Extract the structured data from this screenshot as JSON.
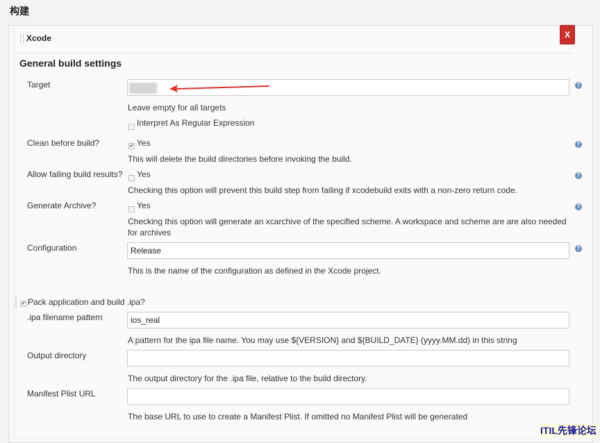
{
  "section": {
    "title": "构建"
  },
  "builder": {
    "title": "Xcode",
    "close_label": "X"
  },
  "general": {
    "title": "General build settings"
  },
  "target": {
    "label": "Target",
    "value": "",
    "help": "Leave empty for all targets",
    "regex_label": "Interpret As Regular Expression"
  },
  "clean": {
    "label": "Clean before build?",
    "yes": "Yes",
    "help": "This will delete the build directories before invoking the build."
  },
  "allow_failing": {
    "label": "Allow failing build results?",
    "yes": "Yes",
    "help": "Checking this option will prevent this build step from failing if xcodebuild exits with a non-zero return code."
  },
  "archive": {
    "label": "Generate Archive?",
    "yes": "Yes",
    "help_line1": "Checking this option will generate an xcarchive of the specified scheme. A workspace and scheme are are also needed",
    "help_line2": "for archives"
  },
  "configuration": {
    "label": "Configuration",
    "value": "Release",
    "help": "This is the name of the configuration as defined in the Xcode project."
  },
  "pack": {
    "label": "Pack application and build .ipa?"
  },
  "ipa_pattern": {
    "label": ".ipa filename pattern",
    "value": "ios_real",
    "help": "A pattern for the ipa file name. You may use ${VERSION} and ${BUILD_DATE} (yyyy.MM.dd) in this string"
  },
  "output_dir": {
    "label": "Output directory",
    "value": "",
    "help": "The output directory for the .ipa file, relative to the build directory."
  },
  "manifest": {
    "label": "Manifest Plist URL",
    "value": "",
    "help": "The base URL to use to create a Manifest Plist. If omitted no Manifest Plist will be generated"
  },
  "watermark": {
    "text": "ITIL先锋论坛"
  },
  "colors": {
    "close_button": "#c9302c",
    "annotation_arrow": "#d9342b",
    "help_icon": "#6b8fb5"
  }
}
